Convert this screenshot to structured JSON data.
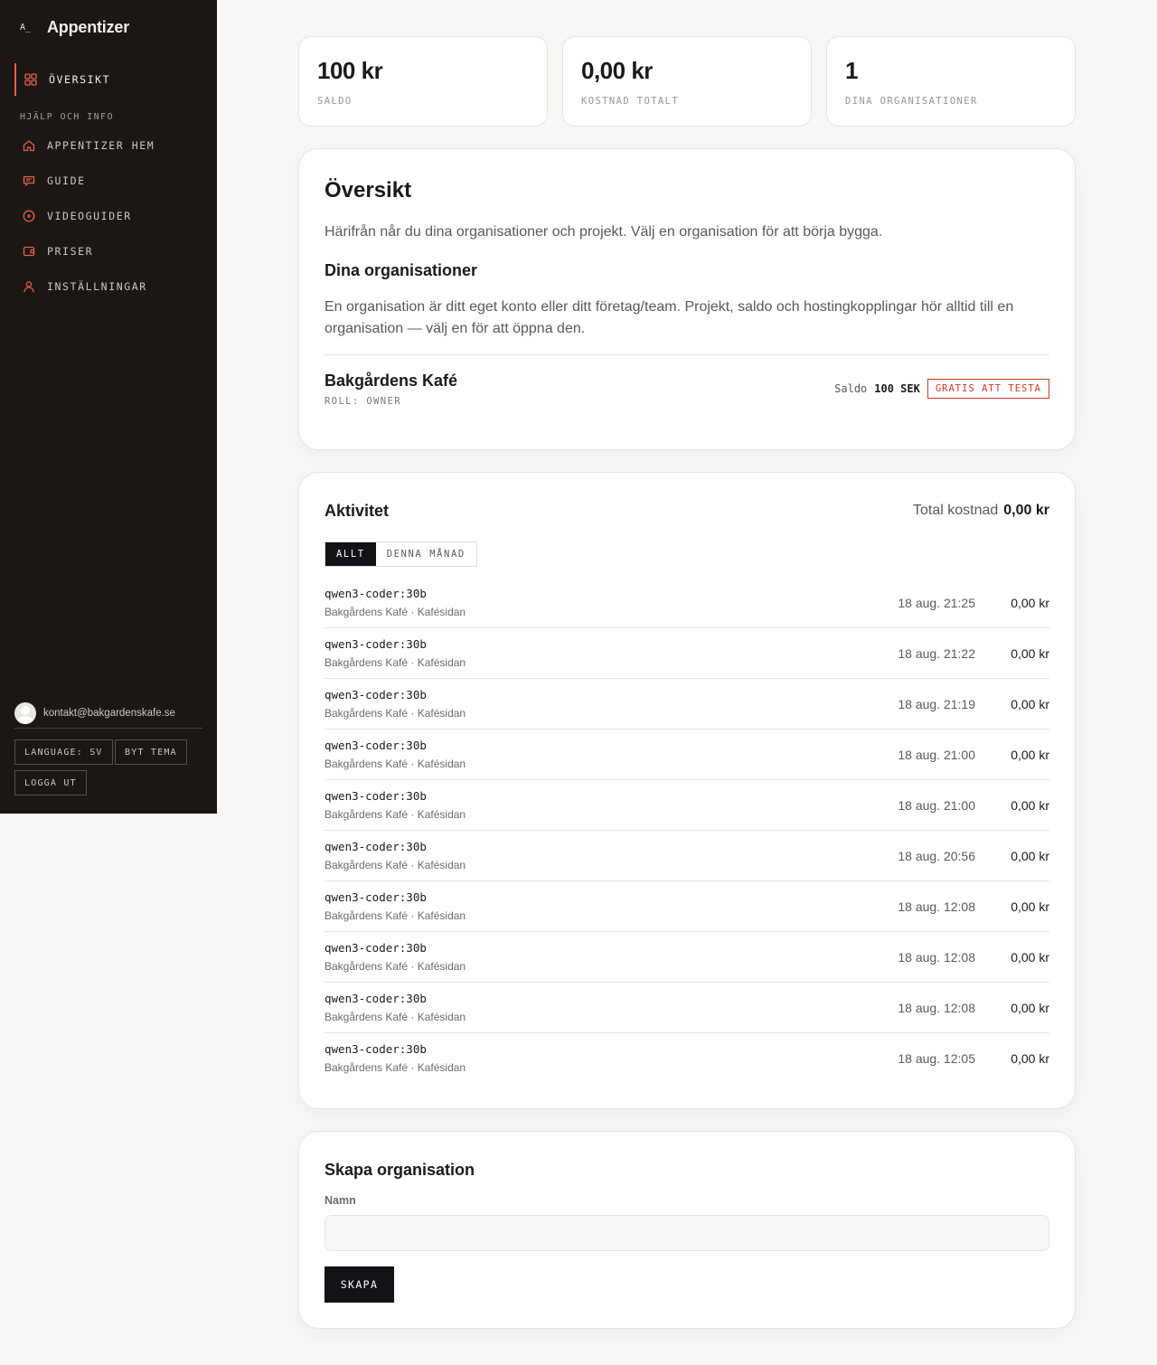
{
  "brand": {
    "mark": "A_",
    "name": "Appentizer"
  },
  "sidebar": {
    "active_item": {
      "label": "ÖVERSIKT",
      "icon": "grid-icon"
    },
    "section_label": "HJÄLP OCH INFO",
    "items": [
      {
        "label": "APPENTIZER HEM",
        "icon": "home-icon"
      },
      {
        "label": "GUIDE",
        "icon": "chat-icon"
      },
      {
        "label": "VIDEOGUIDER",
        "icon": "play-icon"
      },
      {
        "label": "PRISER",
        "icon": "wallet-icon"
      },
      {
        "label": "INSTÄLLNINGAR",
        "icon": "user-icon"
      }
    ],
    "user_email": "kontakt@bakgardenskafe.se",
    "language_button": "LANGUAGE: SV",
    "theme_button": "BYT TEMA",
    "logout_button": "LOGGA UT"
  },
  "stats": [
    {
      "value": "100 kr",
      "label": "SALDO"
    },
    {
      "value": "0,00 kr",
      "label": "KOSTNAD TOTALT"
    },
    {
      "value": "1",
      "label": "DINA ORGANISATIONER"
    }
  ],
  "overview": {
    "title": "Översikt",
    "intro": "Härifrån når du dina organisationer och projekt. Välj en organisation för att börja bygga.",
    "orgs_heading": "Dina organisationer",
    "orgs_text": "En organisation är ditt eget konto eller ditt företag/team. Projekt, saldo och hostingkopplingar hör alltid till en organisation — välj en för att öppna den.",
    "org": {
      "name": "Bakgårdens Kafé",
      "role": "ROLL: OWNER",
      "saldo_label": "Saldo",
      "saldo_value": "100 SEK",
      "badge": "GRATIS ATT TESTA"
    }
  },
  "activity": {
    "title": "Aktivitet",
    "total_label": "Total kostnad",
    "total_value": "0,00 kr",
    "tabs": [
      "ALLT",
      "DENNA MÅNAD"
    ],
    "rows": [
      {
        "model": "qwen3-coder:30b",
        "sub": "Bakgårdens Kafé · Kafésidan",
        "time": "18 aug. 21:25",
        "cost": "0,00 kr"
      },
      {
        "model": "qwen3-coder:30b",
        "sub": "Bakgårdens Kafé · Kafésidan",
        "time": "18 aug. 21:22",
        "cost": "0,00 kr"
      },
      {
        "model": "qwen3-coder:30b",
        "sub": "Bakgårdens Kafé · Kafésidan",
        "time": "18 aug. 21:19",
        "cost": "0,00 kr"
      },
      {
        "model": "qwen3-coder:30b",
        "sub": "Bakgårdens Kafé · Kafésidan",
        "time": "18 aug. 21:00",
        "cost": "0,00 kr"
      },
      {
        "model": "qwen3-coder:30b",
        "sub": "Bakgårdens Kafé · Kafésidan",
        "time": "18 aug. 21:00",
        "cost": "0,00 kr"
      },
      {
        "model": "qwen3-coder:30b",
        "sub": "Bakgårdens Kafé · Kafésidan",
        "time": "18 aug. 20:56",
        "cost": "0,00 kr"
      },
      {
        "model": "qwen3-coder:30b",
        "sub": "Bakgårdens Kafé · Kafésidan",
        "time": "18 aug. 12:08",
        "cost": "0,00 kr"
      },
      {
        "model": "qwen3-coder:30b",
        "sub": "Bakgårdens Kafé · Kafésidan",
        "time": "18 aug. 12:08",
        "cost": "0,00 kr"
      },
      {
        "model": "qwen3-coder:30b",
        "sub": "Bakgårdens Kafé · Kafésidan",
        "time": "18 aug. 12:08",
        "cost": "0,00 kr"
      },
      {
        "model": "qwen3-coder:30b",
        "sub": "Bakgårdens Kafé · Kafésidan",
        "time": "18 aug. 12:05",
        "cost": "0,00 kr"
      }
    ]
  },
  "create_org": {
    "title": "Skapa organisation",
    "name_label": "Namn",
    "name_value": "",
    "name_placeholder": "",
    "submit_label": "SKAPA"
  },
  "colors": {
    "sidebar_bg": "#1c1714",
    "accent": "#e0614c",
    "badge_red": "#cf3a2a",
    "dark_button": "#141216",
    "page_bg": "#f8f7f5"
  }
}
